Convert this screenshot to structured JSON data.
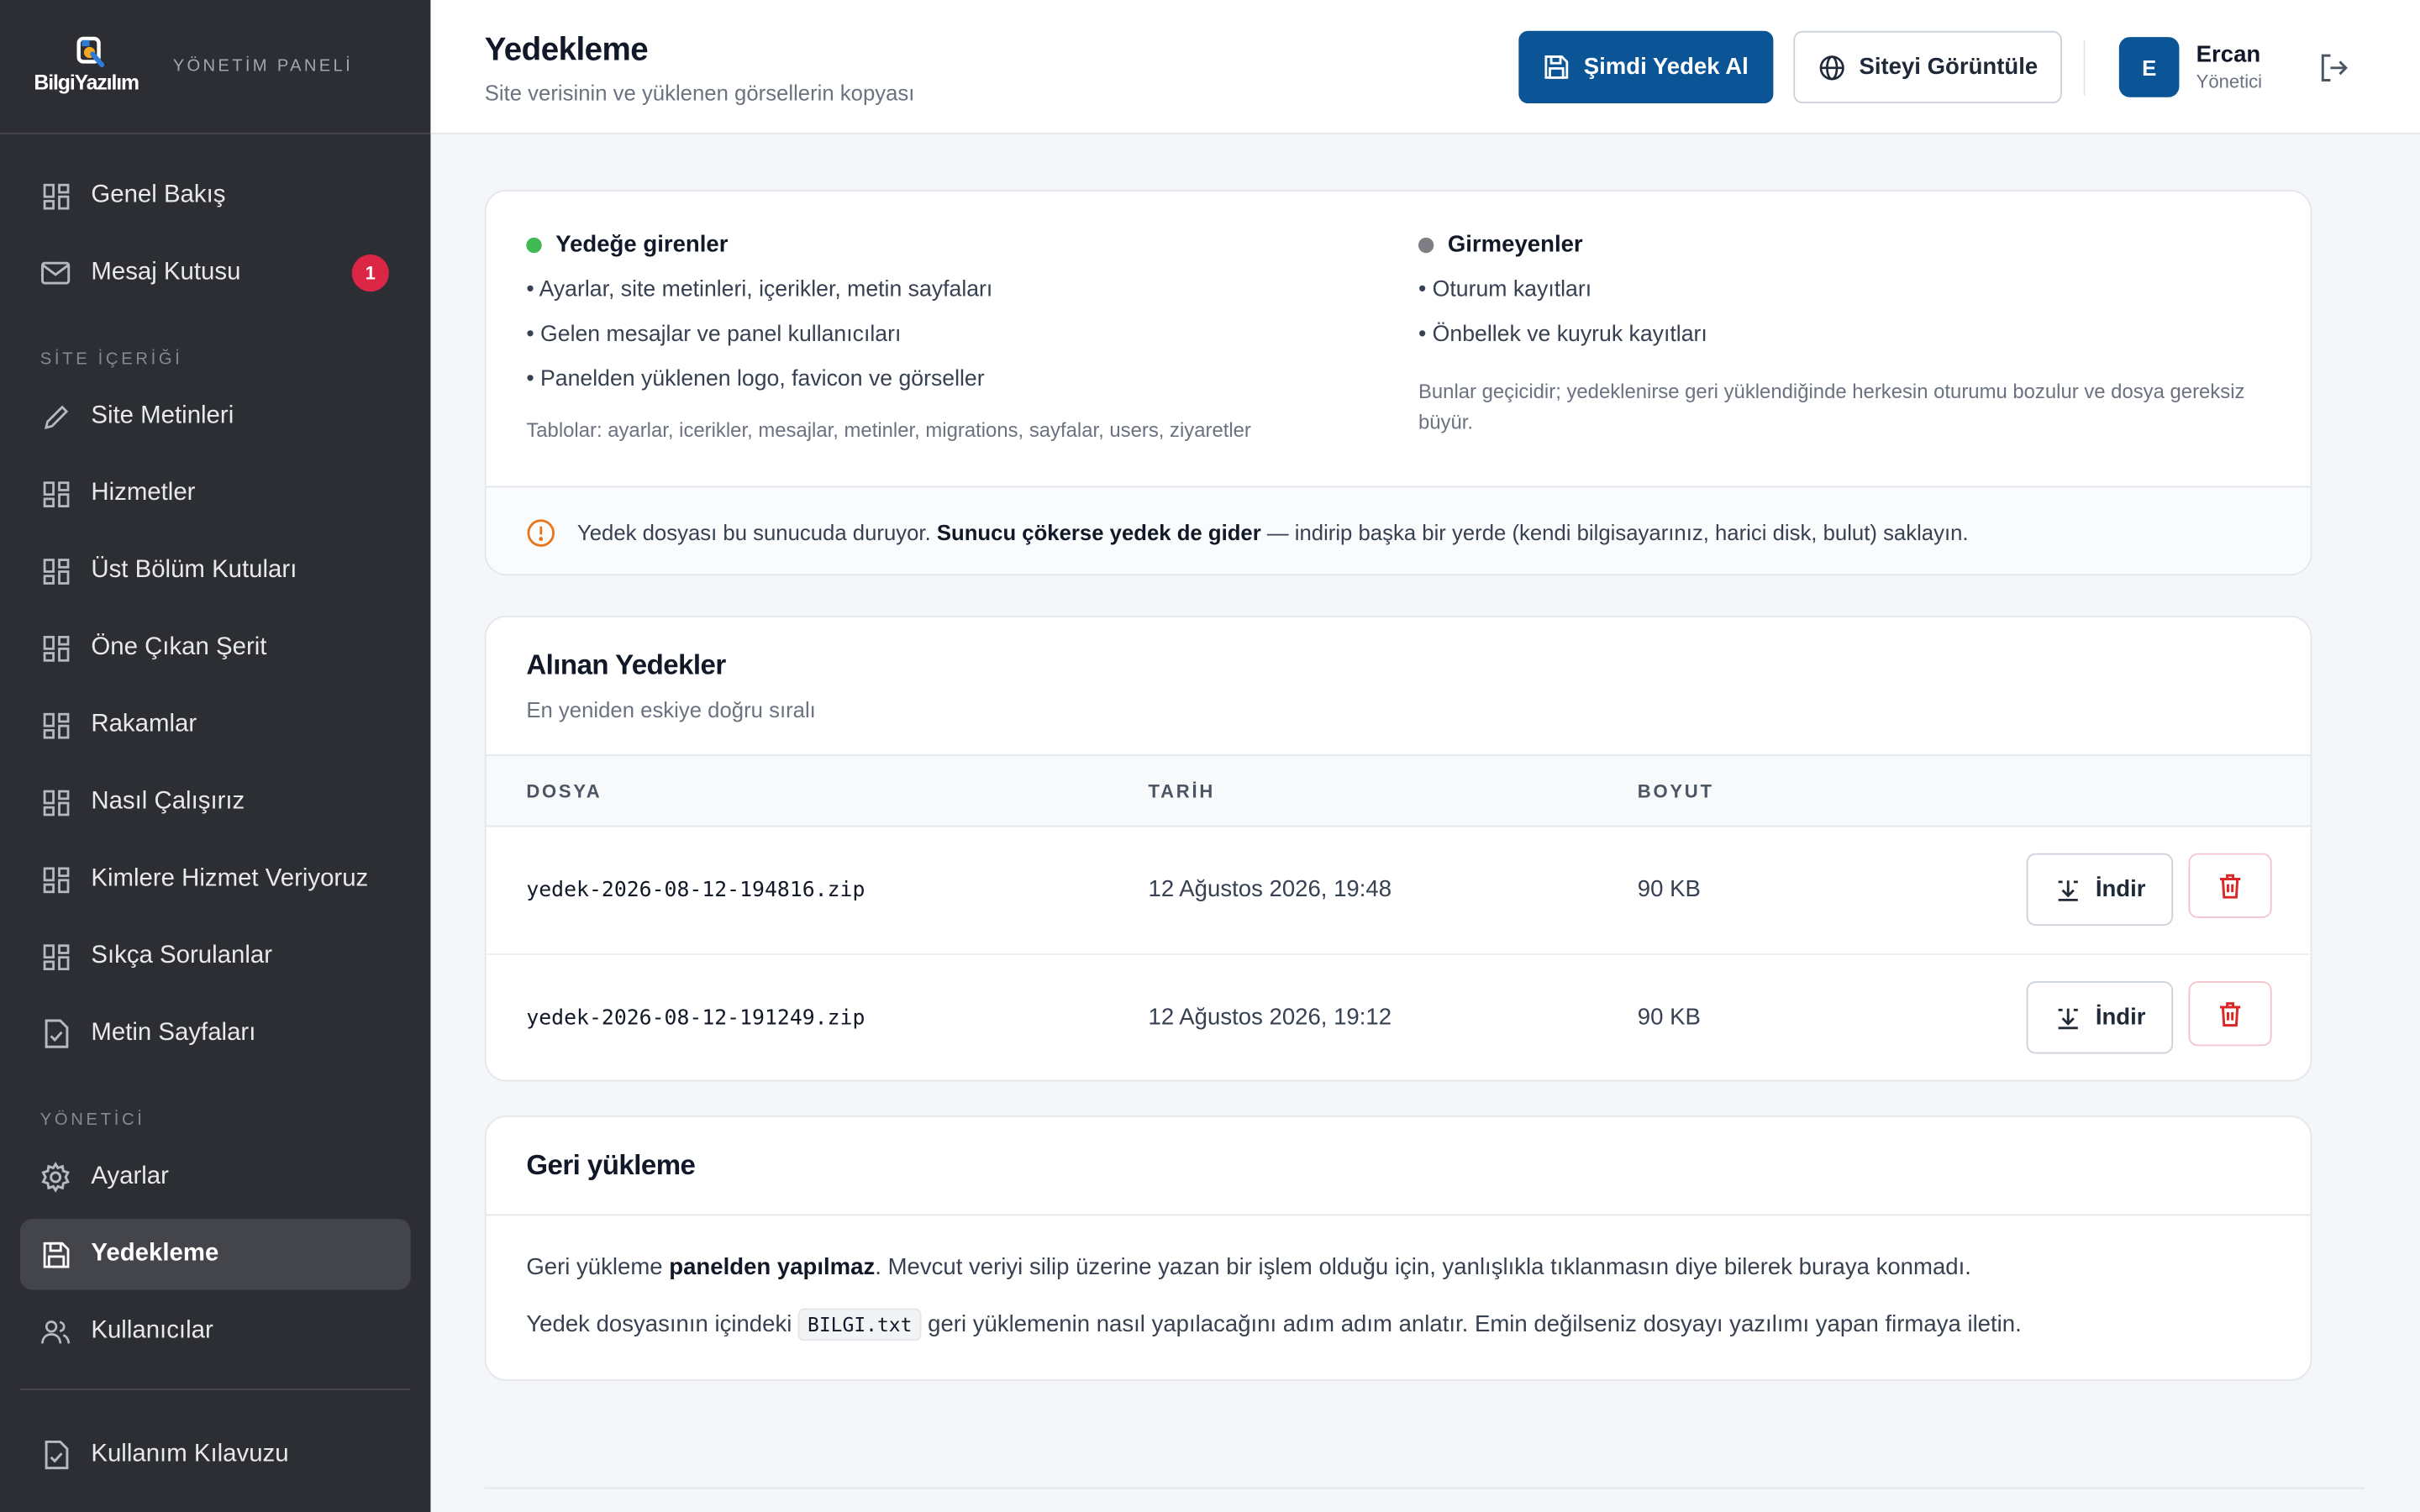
{
  "brand": {
    "logo_text": "BilgiYazılım",
    "subtitle": "YÖNETİM PANELİ"
  },
  "sidebar": {
    "items_top": [
      {
        "label": "Genel Bakış",
        "icon": "grid-icon"
      },
      {
        "label": "Mesaj Kutusu",
        "icon": "mail-icon",
        "badge": "1"
      }
    ],
    "section_content": "SİTE İÇERİĞİ",
    "items_content": [
      {
        "label": "Site Metinleri",
        "icon": "pencil-icon"
      },
      {
        "label": "Hizmetler",
        "icon": "grid-icon"
      },
      {
        "label": "Üst Bölüm Kutuları",
        "icon": "grid-icon"
      },
      {
        "label": "Öne Çıkan Şerit",
        "icon": "grid-icon"
      },
      {
        "label": "Rakamlar",
        "icon": "grid-icon"
      },
      {
        "label": "Nasıl Çalışırız",
        "icon": "grid-icon"
      },
      {
        "label": "Kimlere Hizmet Veriyoruz",
        "icon": "grid-icon"
      },
      {
        "label": "Sıkça Sorulanlar",
        "icon": "grid-icon"
      },
      {
        "label": "Metin Sayfaları",
        "icon": "file-check-icon"
      }
    ],
    "section_admin": "YÖNETİCİ",
    "items_admin": [
      {
        "label": "Ayarlar",
        "icon": "gear-icon"
      },
      {
        "label": "Yedekleme",
        "icon": "save-icon",
        "active": true
      },
      {
        "label": "Kullanıcılar",
        "icon": "users-icon"
      }
    ],
    "footer_item": {
      "label": "Kullanım Kılavuzu",
      "icon": "file-check-icon"
    }
  },
  "header": {
    "title": "Yedekleme",
    "subtitle": "Site verisinin ve yüklenen görsellerin kopyası",
    "primary_button": "Şimdi Yedek Al",
    "secondary_button": "Siteyi Görüntüle",
    "user": {
      "initial": "E",
      "name": "Ercan",
      "role": "Yönetici"
    }
  },
  "info": {
    "included": {
      "title": "Yedeğe girenler",
      "color": "#3fb950",
      "items": [
        "• Ayarlar, site metinleri, içerikler, metin sayfaları",
        "• Gelen mesajlar ve panel kullanıcıları",
        "• Panelden yüklenen logo, favicon ve görseller"
      ],
      "note": "Tablolar: ayarlar, icerikler, mesajlar, metinler, migrations, sayfalar, users, ziyaretler"
    },
    "excluded": {
      "title": "Girmeyenler",
      "color": "#7d7f85",
      "items": [
        "• Oturum kayıtları",
        "• Önbellek ve kuyruk kayıtları"
      ],
      "note": "Bunlar geçicidir; yedeklenirse geri yüklendiğinde herkesin oturumu bozulur ve dosya gereksiz büyür."
    },
    "warning": {
      "before": "Yedek dosyası bu sunucuda duruyor. ",
      "bold": "Sunucu çökerse yedek de gider",
      "after": " — indirip başka bir yerde (kendi bilgisayarınız, harici disk, bulut) saklayın."
    }
  },
  "backups": {
    "title": "Alınan Yedekler",
    "subtitle": "En yeniden eskiye doğru sıralı",
    "columns": [
      "DOSYA",
      "TARİH",
      "BOYUT"
    ],
    "download_label": "İndir",
    "rows": [
      {
        "file": "yedek-2026-08-12-194816.zip",
        "date": "12 Ağustos 2026, 19:48",
        "size": "90 KB"
      },
      {
        "file": "yedek-2026-08-12-191249.zip",
        "date": "12 Ağustos 2026, 19:12",
        "size": "90 KB"
      }
    ]
  },
  "restore": {
    "title": "Geri yükleme",
    "p1_before": "Geri yükleme ",
    "p1_bold": "panelden yapılmaz",
    "p1_after": ". Mevcut veriyi silip üzerine yazan bir işlem olduğu için, yanlışlıkla tıklanmasın diye bilerek buraya konmadı.",
    "p2_before": "Yedek dosyasının içindeki ",
    "p2_code": "BILGI.txt",
    "p2_after": " geri yüklemenin nasıl yapılacağını adım adım anlatır. Emin değilseniz dosyayı yazılımı yapan firmaya iletin."
  },
  "colors": {
    "accent": "#0b5596",
    "danger": "#dc2645",
    "sidebar": "#2d2e33"
  }
}
